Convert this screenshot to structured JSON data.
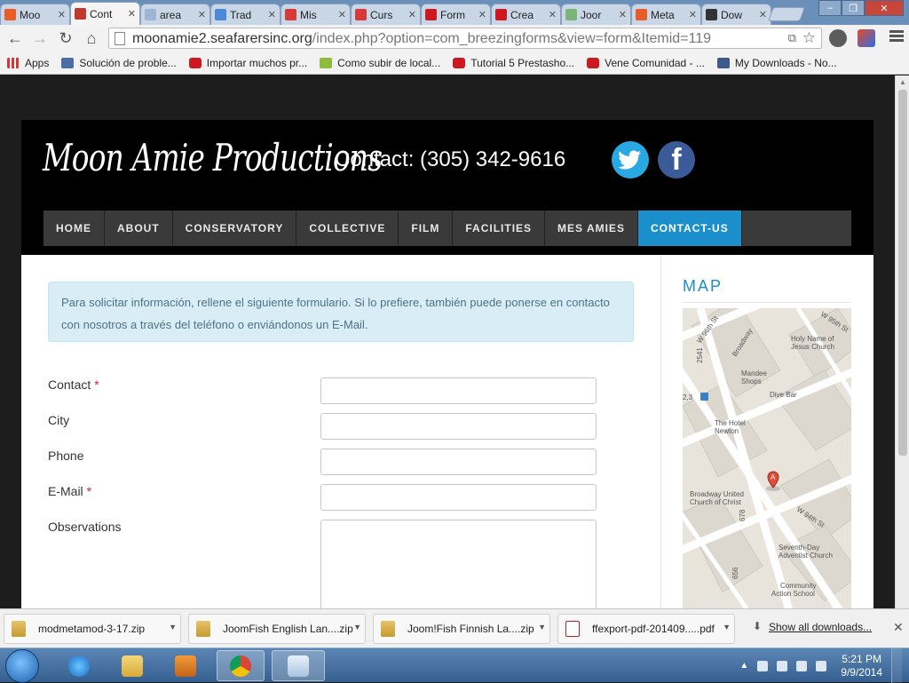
{
  "tabs": [
    {
      "title": "Moo",
      "icon": "joomla-icon",
      "color": "#e85c2a",
      "active": false
    },
    {
      "title": "Cont",
      "icon": "moon-amie-icon",
      "color": "#c0392b",
      "active": true
    },
    {
      "title": "area",
      "icon": "area-icon",
      "color": "#9db6d3",
      "active": false
    },
    {
      "title": "Trad",
      "icon": "translate-icon",
      "color": "#4a8ad6",
      "active": false
    },
    {
      "title": "Mis",
      "icon": "w-icon",
      "color": "#d83a3a",
      "active": false
    },
    {
      "title": "Curs",
      "icon": "w-icon",
      "color": "#d83a3a",
      "active": false
    },
    {
      "title": "Form",
      "icon": "youtube-icon",
      "color": "#cc181e",
      "active": false
    },
    {
      "title": "Crea",
      "icon": "youtube-icon",
      "color": "#cc181e",
      "active": false
    },
    {
      "title": "Joor",
      "icon": "page-icon",
      "color": "#7bb57b",
      "active": false
    },
    {
      "title": "Meta",
      "icon": "joomla-icon",
      "color": "#e85c2a",
      "active": false
    },
    {
      "title": "Dow",
      "icon": "download-icon",
      "color": "#333333",
      "active": false
    }
  ],
  "toolbar": {
    "url_host": "moonamie2.seafarersinc.org",
    "url_path": "/index.php?option=com_breezingforms&view=form&Itemid=119"
  },
  "bookmarks": [
    {
      "label": "Apps",
      "icon": "apps-icon"
    },
    {
      "label": "Solución de proble...",
      "icon": "tools-icon"
    },
    {
      "label": "Importar muchos pr...",
      "icon": "youtube-icon"
    },
    {
      "label": "Como subir de local...",
      "icon": "android-icon"
    },
    {
      "label": "Tutorial 5 Prestasho...",
      "icon": "youtube-icon"
    },
    {
      "label": "Vene Comunidad - ...",
      "icon": "youtube-icon"
    },
    {
      "label": "My Downloads - No...",
      "icon": "hash-icon"
    }
  ],
  "site": {
    "logo": "Moon Amie Productions",
    "contact": "Contact: (305) 342-9616",
    "nav": [
      "HOME",
      "ABOUT",
      "CONSERVATORY",
      "COLLECTIVE",
      "FILM",
      "FACILITIES",
      "MES AMIES",
      "CONTACT-US"
    ],
    "nav_active": "CONTACT-US",
    "info": "Para solicitar información, rellene el siguiente formulario. Si lo prefiere, también puede ponerse en contacto con nosotros  a través del teléfono o enviándonos un E-Mail.",
    "form": {
      "contact_label": "Contact",
      "city_label": "City",
      "phone_label": "Phone",
      "email_label": "E-Mail",
      "observations_label": "Observations",
      "required_mark": "*"
    },
    "sidebar_title": "MAP",
    "map": {
      "streets": [
        "W 96th St",
        "Broadway",
        "W 94th St",
        "W 95th St"
      ],
      "places": [
        "Holy Name of",
        "Jesus Church",
        "Mandee",
        "Shops",
        "Dive Bar",
        "The Hotel",
        "Newton",
        "Broadway United",
        "Church of Christ",
        "Seventh-Day",
        "Adventist Church",
        "Community",
        "Action School"
      ],
      "marker": "A",
      "numbers": [
        "2541",
        "2,3",
        "678",
        "656"
      ]
    }
  },
  "downloads": [
    {
      "name": "modmetamod-3-17.zip",
      "type": "zip"
    },
    {
      "name": "JoomFish English Lan....zip",
      "type": "zip"
    },
    {
      "name": "Joom!Fish Finnish La....zip",
      "type": "zip"
    },
    {
      "name": "ffexport-pdf-201409.....pdf",
      "type": "pdf"
    }
  ],
  "show_all": "Show all downloads...",
  "clock": {
    "time": "5:21 PM",
    "date": "9/9/2014"
  },
  "colors": {
    "accent": "#1a8fcb",
    "header": "#000000",
    "twitter": "#29a9e1",
    "facebook": "#3a5a98",
    "info_bg": "#d9edf7"
  }
}
